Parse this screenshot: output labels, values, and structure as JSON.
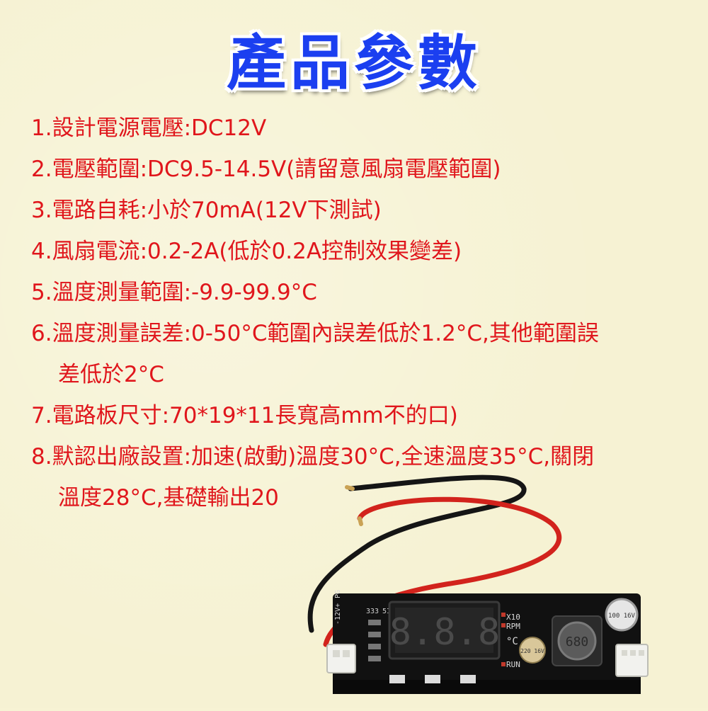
{
  "title": "產品參數",
  "specs": [
    {
      "line": "1.設計電源電壓:DC12V"
    },
    {
      "line": "2.電壓範圍:DC9.5-14.5V(請留意風扇電壓範圍)"
    },
    {
      "line": "3.電路自耗:小於70mA(12V下測試)"
    },
    {
      "line": "4.風扇電流:0.2-2A(低於0.2A控制效果變差)"
    },
    {
      "line": "5.溫度測量範圍:-9.9-99.9°C"
    },
    {
      "line": "6.溫度測量誤差:0-50°C範圍內誤差低於1.2°C,其他範圍誤",
      "cont": "差低於2°C"
    },
    {
      "line": "7.電路板尺寸:70*19*11長寬高mm不的口)"
    },
    {
      "line": "8.默認出廠設置:加速(啟動)溫度30°C,全速溫度35°C,關閉",
      "cont": "溫度28°C,基礎輸出20"
    }
  ],
  "board": {
    "pin_labels": [
      "-12V+",
      "PG"
    ],
    "top_labels": [
      "333",
      "5I2"
    ],
    "unit_labels": [
      "X10",
      "RPM",
      "°C",
      "RUN"
    ],
    "inductor_label": "680",
    "cap_large_label": "100 16V",
    "cap_small_label": "220 16V",
    "display_digits": "8.8.8"
  },
  "colors": {
    "background": "#f6f2d3",
    "title": "#1b3ff0",
    "spec_text": "#e0161c",
    "pcb": "#111111",
    "wire_red": "#d2231c",
    "wire_black": "#151515"
  }
}
